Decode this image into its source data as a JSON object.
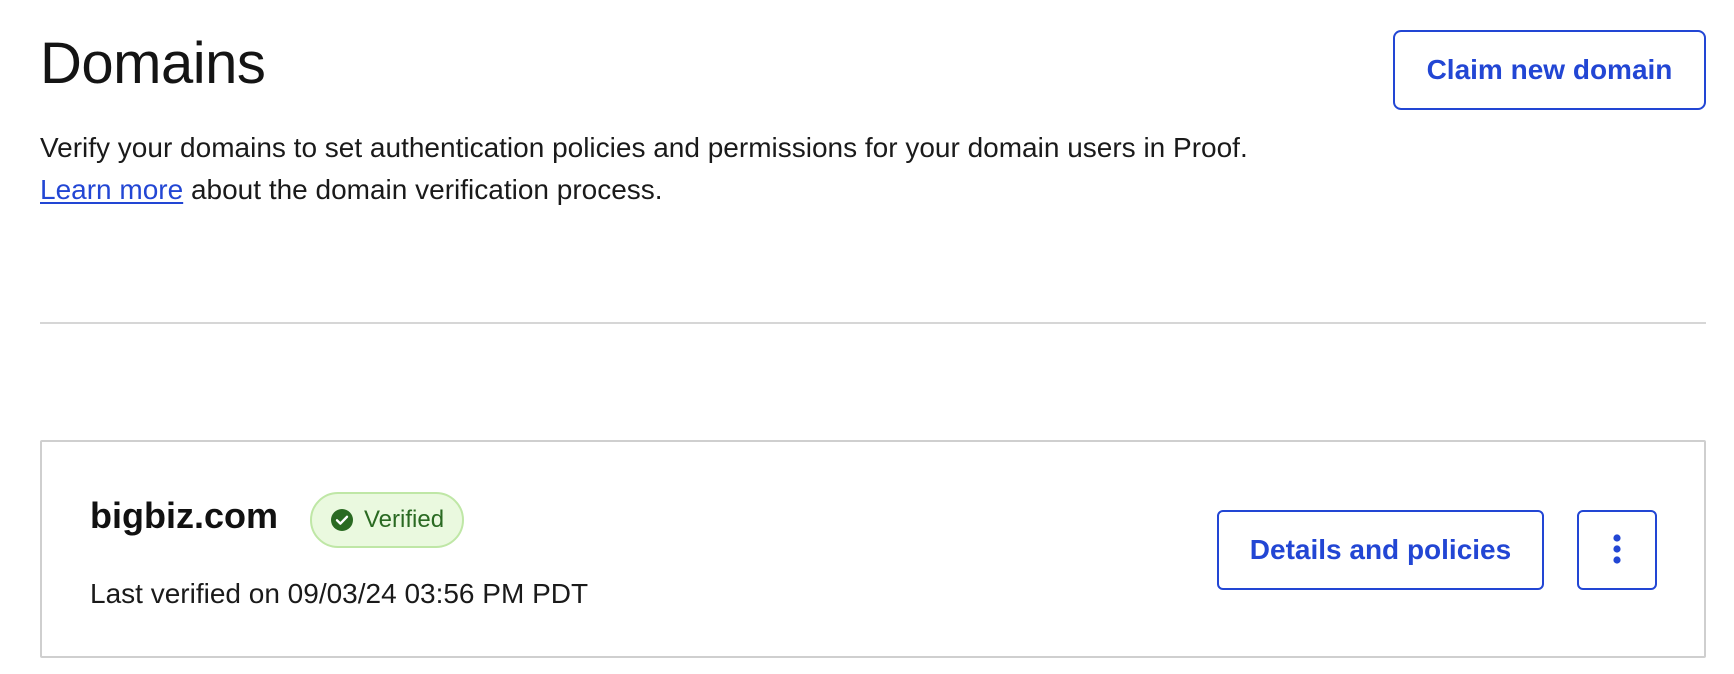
{
  "header": {
    "title": "Domains",
    "claim_button_label": "Claim new domain"
  },
  "description": {
    "line1": "Verify your domains to set authentication policies and permissions for your domain users in Proof.",
    "learn_more_link": "Learn more",
    "line2_rest": " about the domain verification process."
  },
  "domains": [
    {
      "name": "bigbiz.com",
      "status": "Verified",
      "status_icon": "check-circle-icon",
      "last_verified": "Last verified on 09/03/24 03:56 PM PDT",
      "details_button_label": "Details and policies",
      "more_icon": "kebab-menu-icon"
    }
  ],
  "colors": {
    "accent": "#2246d4",
    "badge_bg": "#eaf9df",
    "badge_border": "#bfe7a6",
    "badge_text": "#2a6a22",
    "divider": "#d6d6d6"
  }
}
